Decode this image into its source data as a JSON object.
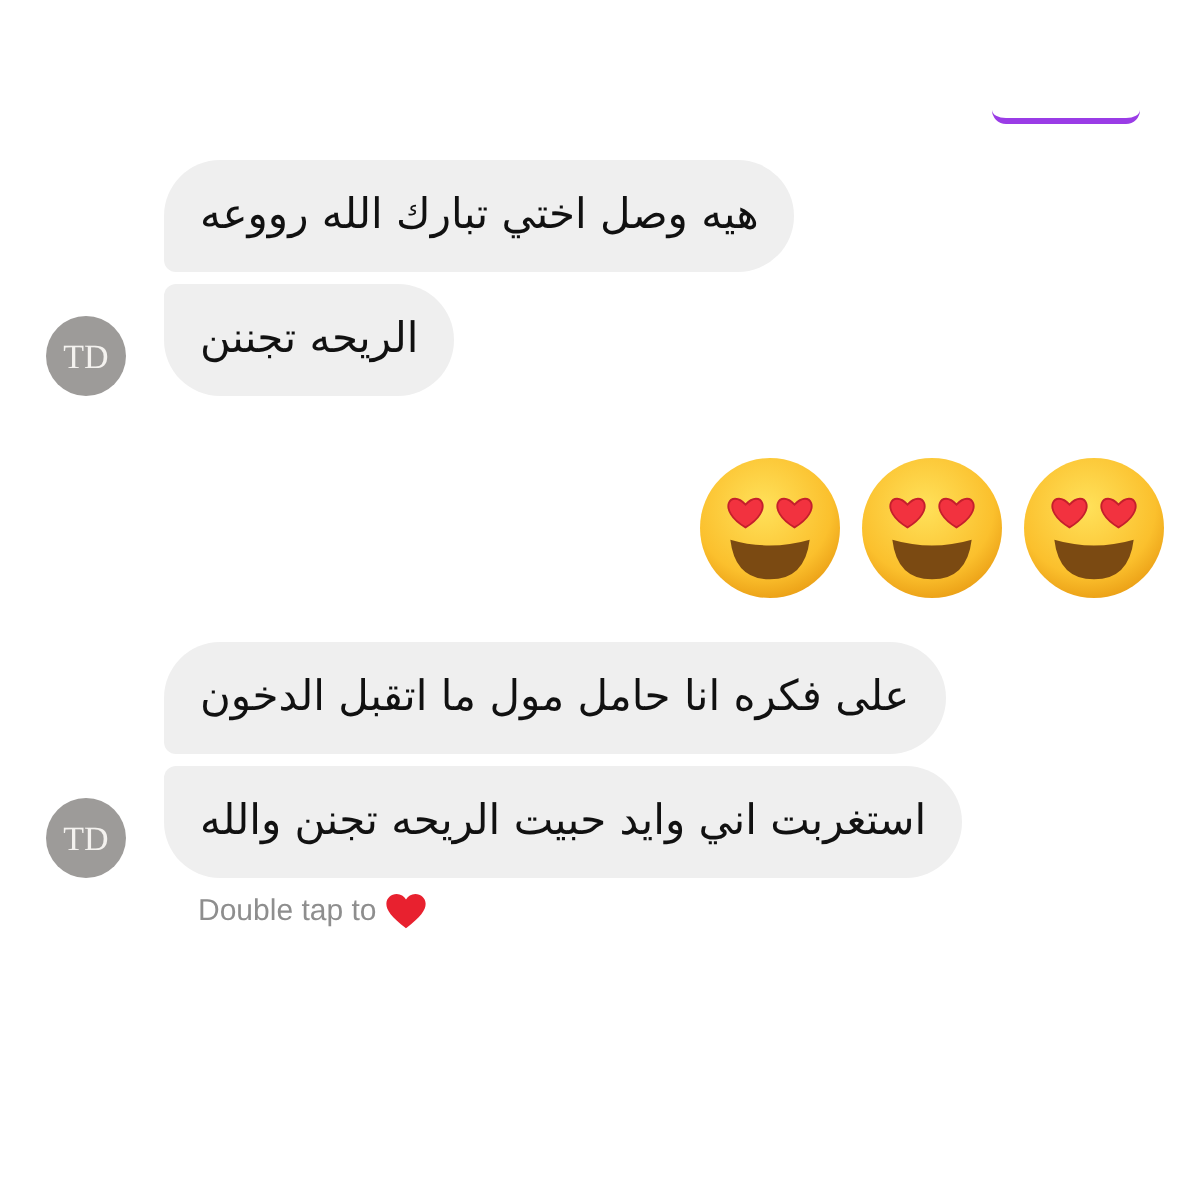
{
  "conversation": [
    {
      "kind": "incoming",
      "avatar": {
        "monogram": "TD"
      },
      "messages": [
        {
          "kind": "text",
          "text": "هيه وصل اختي تبارك الله رووعه"
        },
        {
          "kind": "text",
          "text": "الريحه تجننن"
        }
      ]
    },
    {
      "kind": "outgoing",
      "messages": [
        {
          "kind": "emoji",
          "emojis": [
            {
              "kind": "heart-eyes"
            },
            {
              "kind": "heart-eyes"
            },
            {
              "kind": "heart-eyes"
            }
          ]
        }
      ]
    },
    {
      "kind": "incoming",
      "avatar": {
        "monogram": "TD"
      },
      "messages": [
        {
          "kind": "text",
          "text": "على فكره انا حامل مول ما اتقبل الدخون"
        },
        {
          "kind": "text",
          "text": "استغربت اني وايد حبيت الريحه تجنن والله"
        }
      ]
    }
  ],
  "hint": {
    "text": "Double tap to"
  }
}
